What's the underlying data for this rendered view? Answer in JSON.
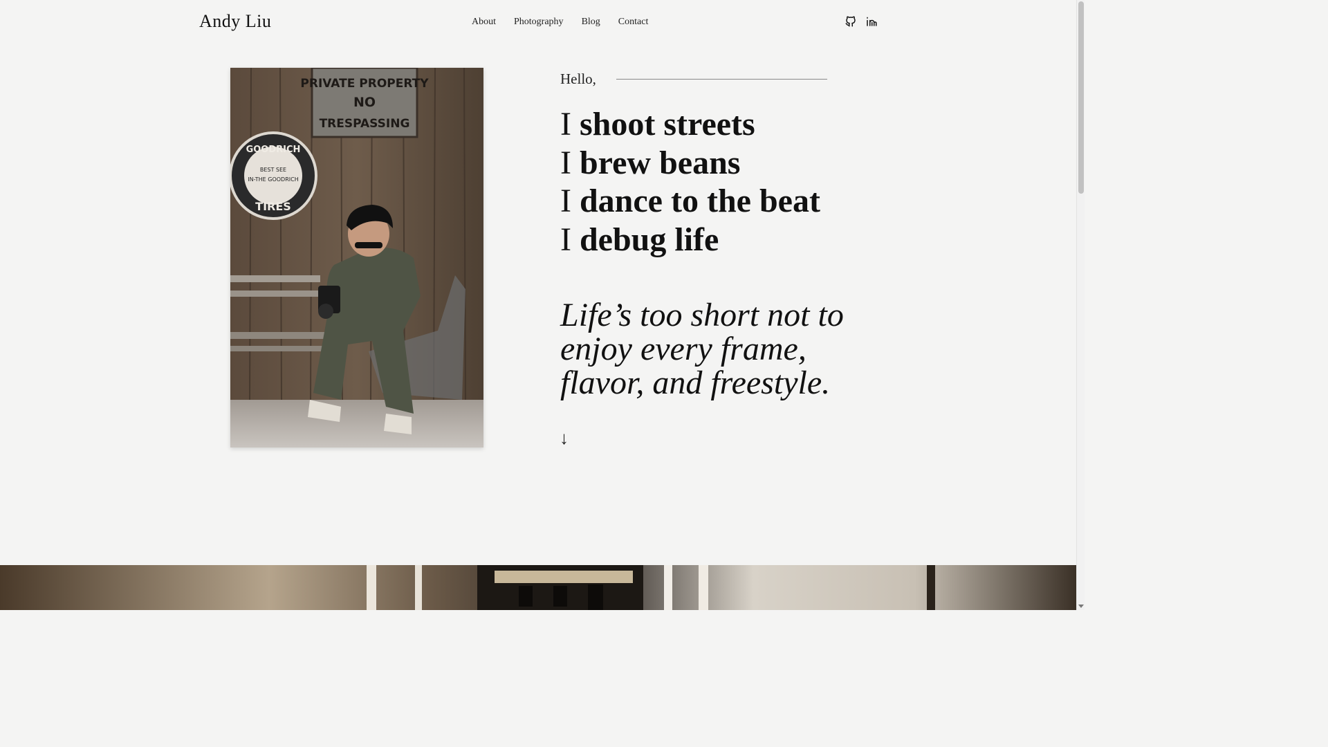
{
  "header": {
    "brand": "Andy Liu",
    "nav": [
      {
        "label": "About"
      },
      {
        "label": "Photography"
      },
      {
        "label": "Blog"
      },
      {
        "label": "Contact"
      }
    ],
    "social": [
      "github-icon",
      "linkedin-icon"
    ]
  },
  "hero": {
    "greeting": "Hello,",
    "lines": [
      {
        "prefix": "I",
        "text": "shoot streets"
      },
      {
        "prefix": "I",
        "text": "brew beans"
      },
      {
        "prefix": "I",
        "text": "dance to the beat"
      },
      {
        "prefix": "I",
        "text": "debug life"
      }
    ],
    "quote": "Life’s too short not to enjoy every frame, flavor, and freestyle.",
    "scroll_arrow": "↓"
  },
  "portrait": {
    "sign_text": "PRIVATE PROPERTY NO TRESPASSING",
    "badge_text": "GOODRICH TIRES"
  }
}
